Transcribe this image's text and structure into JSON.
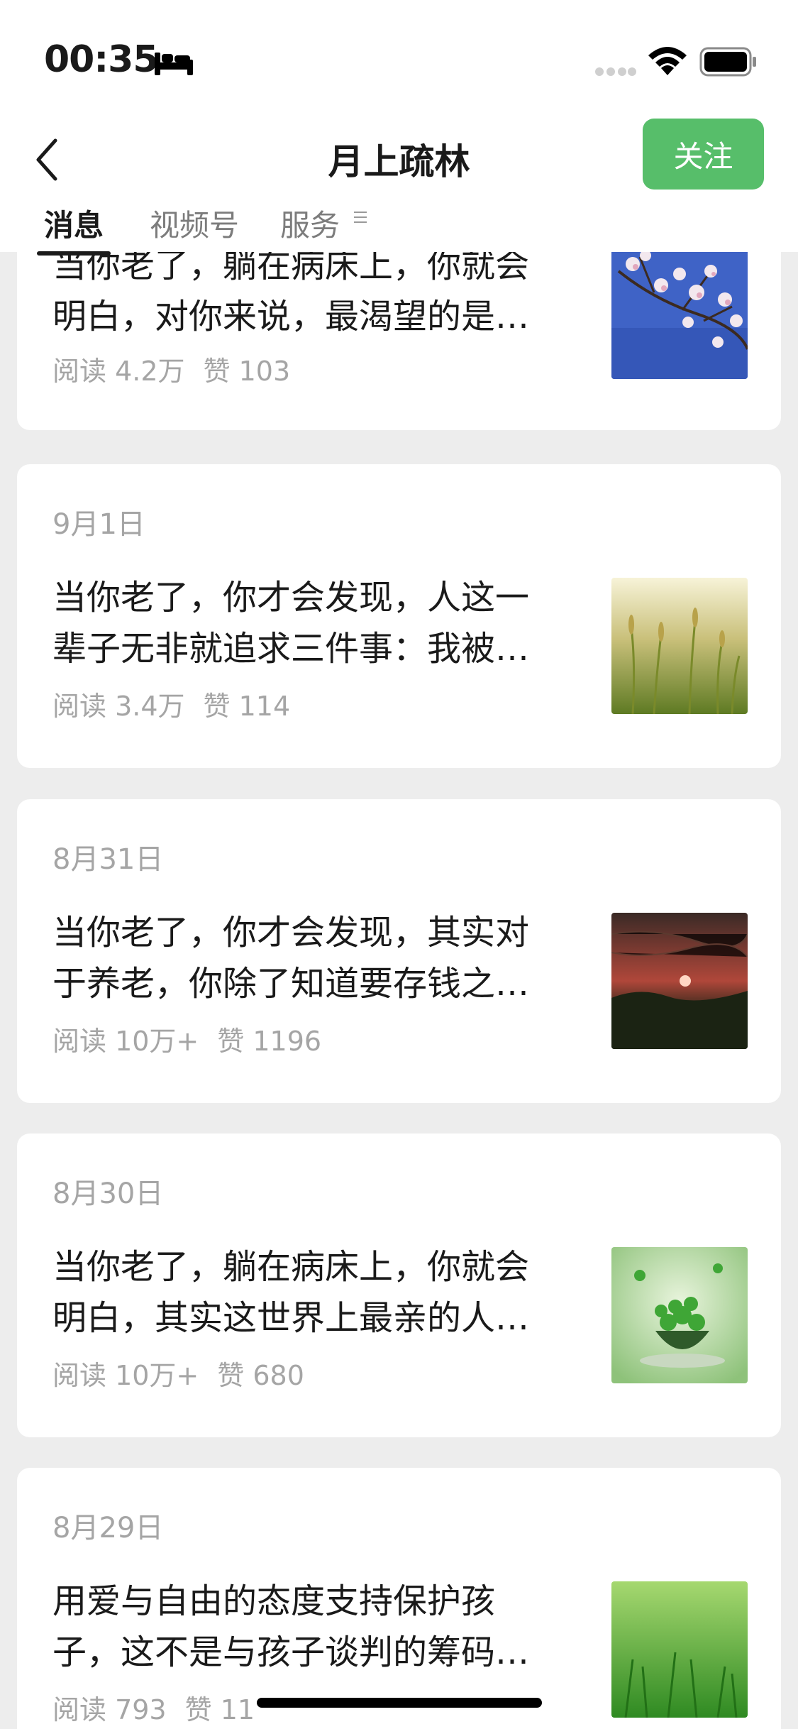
{
  "status_bar": {
    "time": "00:35"
  },
  "header": {
    "title": "月上疏林",
    "follow_label": "关注"
  },
  "tabs": [
    {
      "label": "消息",
      "active": true
    },
    {
      "label": "视频号",
      "active": false
    },
    {
      "label": "服务",
      "active": false
    }
  ],
  "articles": [
    {
      "date": "",
      "line1": "当你老了，躺在病床上，你就会",
      "line2": "明白，对你来说，最渴望的是…",
      "reads": "阅读 4.2万",
      "likes": "赞 103",
      "thumb": "magnolia-blossoms-blue-sky"
    },
    {
      "date": "9月1日",
      "line1": "当你老了，你才会发现，人这一",
      "line2": "辈子无非就追求三件事：我被…",
      "reads": "阅读 3.4万",
      "likes": "赞 114",
      "thumb": "golden-grass-field"
    },
    {
      "date": "8月31日",
      "line1": "当你老了，你才会发现，其实对",
      "line2": "于养老，你除了知道要存钱之…",
      "reads": "阅读 10万+",
      "likes": "赞 1196",
      "thumb": "red-sunset-water"
    },
    {
      "date": "8月30日",
      "line1": "当你老了，躺在病床上，你就会",
      "line2": "明白，其实这世界上最亲的人…",
      "reads": "阅读 10万+",
      "likes": "赞 680",
      "thumb": "clover-in-cup"
    },
    {
      "date": "8月29日",
      "line1": "用爱与自由的态度支持保护孩",
      "line2": "子，这不是与孩子谈判的筹码…",
      "reads": "阅读 793",
      "likes": "赞 11",
      "thumb": "green-grass-closeup"
    }
  ]
}
